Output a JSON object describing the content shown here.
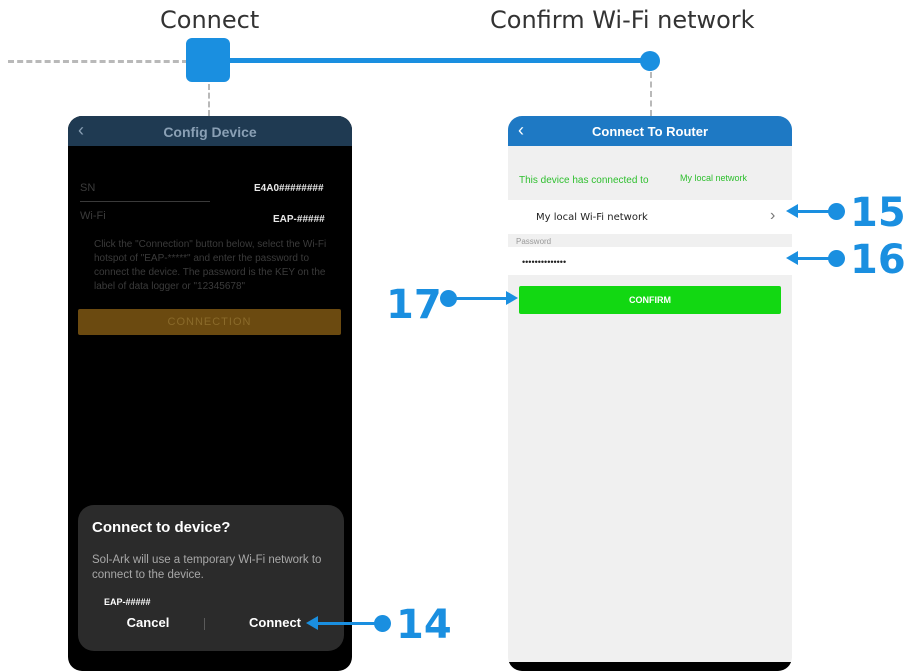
{
  "steps": {
    "connect_title": "Connect",
    "confirm_title": "Confirm Wi-Fi network"
  },
  "left_phone": {
    "title": "Config Device",
    "sn_label": "SN",
    "sn_value": "E4A0########",
    "wifi_label": "Wi-Fi",
    "wifi_value": "EAP-#####",
    "instruction": "Click the \"Connection\" button below, select the Wi-Fi hotspot of \"EAP-*****\" and enter the password to connect the device. The password is the KEY on the label of data logger or \"12345678\"",
    "connection_button": "CONNECTION",
    "dialog": {
      "title": "Connect to device?",
      "text": "Sol-Ark will use a temporary Wi-Fi network to connect to the device.",
      "network": "EAP-#####",
      "cancel": "Cancel",
      "connect": "Connect"
    }
  },
  "right_phone": {
    "title": "Connect To Router",
    "connected_text": "This device has connected to",
    "connected_network": "My local network",
    "selected_network": "My local Wi-Fi network",
    "password_label": "Password",
    "password_value": "••••••••••••••",
    "confirm_button": "CONFIRM"
  },
  "callouts": {
    "c14": "14",
    "c15": "15",
    "c16": "16",
    "c17": "17"
  },
  "colors": {
    "accent": "#1a8fe0",
    "confirm_green": "#12d812",
    "header_blue": "#1e79c4",
    "connected_green": "#2ebf2e"
  },
  "icons": [
    "back-chevron-icon",
    "chevron-right-icon",
    "callout-arrow-icon"
  ]
}
